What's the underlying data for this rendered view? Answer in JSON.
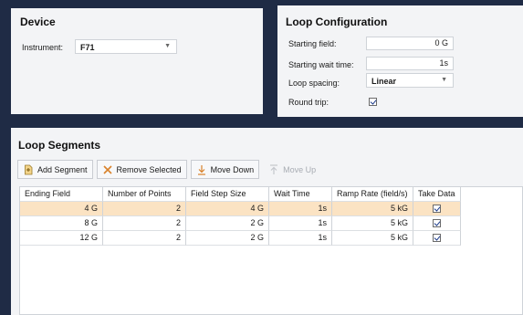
{
  "device": {
    "title": "Device",
    "instrument_label": "Instrument:",
    "instrument_value": "F71"
  },
  "loop": {
    "title": "Loop Configuration",
    "starting_field_label": "Starting field:",
    "starting_field_value": "0 G",
    "wait_time_label": "Starting wait time:",
    "wait_time_value": "1s",
    "spacing_label": "Loop spacing:",
    "spacing_value": "Linear",
    "round_trip_label": "Round trip:",
    "round_trip_checked": true
  },
  "segments": {
    "title": "Loop Segments",
    "toolbar": {
      "add": "Add Segment",
      "remove": "Remove Selected",
      "move_down": "Move Down",
      "move_up": "Move Up"
    },
    "columns": [
      "Ending Field",
      "Number of Points",
      "Field Step Size",
      "Wait Time",
      "Ramp Rate (field/s)",
      "Take Data"
    ],
    "rows": [
      {
        "ending": "4 G",
        "points": "2",
        "step": "4 G",
        "wait": "1s",
        "ramp": "5 kG",
        "take": true,
        "selected": true
      },
      {
        "ending": "8 G",
        "points": "2",
        "step": "2 G",
        "wait": "1s",
        "ramp": "5 kG",
        "take": true,
        "selected": false
      },
      {
        "ending": "12 G",
        "points": "2",
        "step": "2 G",
        "wait": "1s",
        "ramp": "5 kG",
        "take": true,
        "selected": false
      }
    ]
  },
  "colors": {
    "background": "#1f2b45",
    "panel": "#f3f4f6",
    "selected_row": "#fbe3c3"
  }
}
